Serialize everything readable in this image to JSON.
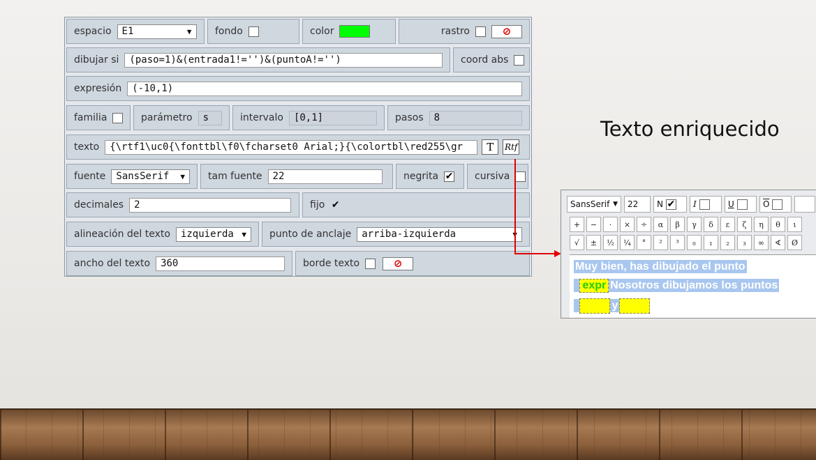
{
  "panel": {
    "row1": {
      "espacio_label": "espacio",
      "espacio_value": "E1",
      "fondo_label": "fondo",
      "color_label": "color",
      "color_value": "#00ff00",
      "rastro_label": "rastro",
      "no_symbol": "⊘"
    },
    "row2": {
      "dibujar_label": "dibujar si",
      "dibujar_value": "(paso=1)&(entrada1!='')&(puntoA!='')",
      "coord_label": "coord abs"
    },
    "row3": {
      "expresion_label": "expresión",
      "expresion_value": "(-10,1)"
    },
    "row4": {
      "familia_label": "familia",
      "parametro_label": "parámetro",
      "parametro_value": "s",
      "intervalo_label": "intervalo",
      "intervalo_value": "[0,1]",
      "pasos_label": "pasos",
      "pasos_value": "8"
    },
    "row5": {
      "texto_label": "texto",
      "texto_value": "{\\rtf1\\uc0{\\fonttbl\\f0\\fcharset0 Arial;}{\\colortbl\\red255\\gr",
      "t_button": "T",
      "rtf_button": "Rtf"
    },
    "row6": {
      "fuente_label": "fuente",
      "fuente_value": "SansSerif",
      "tam_label": "tam fuente",
      "tam_value": "22",
      "negrita_label": "negrita",
      "negrita_checked": "✔",
      "cursiva_label": "cursiva"
    },
    "row7": {
      "decimales_label": "decimales",
      "decimales_value": "2",
      "fijo_label": "fijo",
      "fijo_checked": "✔"
    },
    "row8": {
      "alineacion_label": "alineación del texto",
      "alineacion_value": "izquierda",
      "anclaje_label": "punto de anclaje",
      "anclaje_value": "arriba-izquierda"
    },
    "row9": {
      "ancho_label": "ancho del texto",
      "ancho_value": "360",
      "borde_label": "borde texto",
      "no_symbol": "⊘"
    }
  },
  "title": "Texto enriquecido",
  "editor": {
    "font_value": "SansSerif",
    "size_value": "22",
    "bold_label": "N",
    "bold_checked": "✔",
    "italic_label": "I",
    "underline_label": "U",
    "overline_label": "O",
    "symbols_row1": [
      "+",
      "−",
      "·",
      "×",
      "÷",
      "α",
      "β",
      "γ",
      "δ",
      "ε",
      "ζ",
      "η",
      "θ",
      "ι"
    ],
    "symbols_row2": [
      "√",
      "±",
      "½",
      "¼",
      "°",
      "²",
      "³",
      "₀",
      "₁",
      "₂",
      "₃",
      "∞",
      "∢",
      "Ø"
    ],
    "line1": "Muy bien, has dibujado el punto",
    "expr_label": "expr",
    "line2": "Nosotros dibujamos los puntos",
    "y_label": "y"
  },
  "colors": {
    "accent_arrow": "#e00000",
    "highlight": "#a8c6ef",
    "field_box": "#ffff00"
  }
}
